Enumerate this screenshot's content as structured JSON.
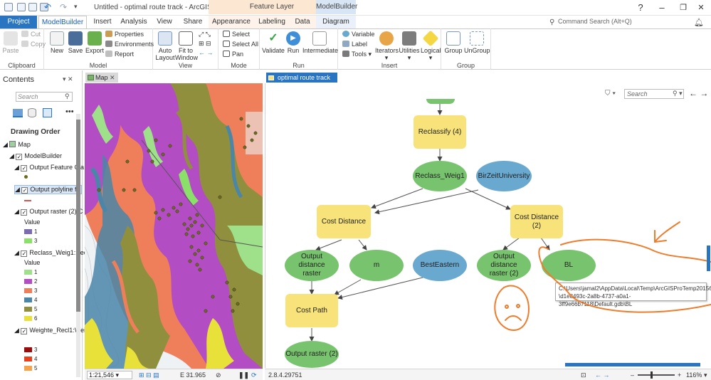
{
  "window": {
    "title": "Untitled - optimal route track - ArcGIS Pro",
    "help": "?",
    "minimize": "–",
    "restore": "❐",
    "close": "✕"
  },
  "context_headers": {
    "feature_layer": "Feature Layer",
    "modelbuilder": "ModelBuilder"
  },
  "tabs": [
    "Project",
    "ModelBuilder",
    "Insert",
    "Analysis",
    "View",
    "Share",
    "Appearance",
    "Labeling",
    "Data",
    "Diagram"
  ],
  "command_search_placeholder": "Command Search (Alt+Q)",
  "ribbon": {
    "clipboard": {
      "paste": "Paste",
      "cut": "Cut",
      "copy": "Copy",
      "label": "Clipboard"
    },
    "model": {
      "new": "New",
      "save": "Save",
      "export": "Export",
      "properties": "Properties",
      "environments": "Environments",
      "report": "Report",
      "label": "Model"
    },
    "view": {
      "auto_layout": "Auto Layout",
      "fit_to_window": "Fit to Window",
      "label": "View"
    },
    "mode": {
      "select": "Select",
      "select_all": "Select All",
      "pan": "Pan",
      "label": "Mode"
    },
    "run": {
      "validate": "Validate",
      "run": "Run",
      "intermediate": "Intermediate",
      "label": "Run"
    },
    "insert": {
      "variable": "Variable",
      "label_btn": "Label",
      "tools": "Tools",
      "iterators": "Iterators",
      "utilities": "Utilities",
      "logical": "Logical",
      "label": "Insert"
    },
    "group": {
      "group": "Group",
      "ungroup": "UnGroup",
      "label": "Group"
    }
  },
  "contents": {
    "title": "Contents",
    "search_placeholder": "Search",
    "drawing_order": "Drawing Order",
    "items": {
      "map": "Map",
      "modelbuilder": "ModelBuilder",
      "output_feature": "Output Feature Cla",
      "output_polyline": "Output polyline fe",
      "output_raster": "Output raster (2):C",
      "value1": "Value",
      "reclass": "Reclass_Weig1:Rec",
      "value2": "Value",
      "weighted": "Weighte_Recl1:Wei"
    },
    "legend1": [
      "1",
      "3"
    ],
    "legend2": [
      "1",
      "2",
      "3",
      "4",
      "5",
      "6"
    ],
    "legend3": [
      "3",
      "4",
      "5"
    ],
    "colors": {
      "purple": "#7b6bb0",
      "green": "#8be06a",
      "lightgreen": "#9fe08a",
      "magenta": "#b34dc4",
      "salmon": "#ef7f5a",
      "steel": "#4a86a8",
      "olive": "#8f8f3e",
      "yellow": "#e8e13a",
      "darkred": "#9b0b0b",
      "red": "#e8401c",
      "orange": "#f6a24b"
    }
  },
  "map": {
    "tab_label": "Map",
    "scale": "1:21,546",
    "coords": "E 31.965"
  },
  "modelbuilder": {
    "tab_label": "optimal route track",
    "search_placeholder": "Search",
    "nodes": {
      "reclassify": "Reclassify (4)",
      "reclass_weig1": "Reclass_Weig1",
      "birzeit": "BirZeitUniversity",
      "cost_distance": "Cost Distance",
      "cost_distance2": "Cost Distance (2)",
      "output_distance": "Output distance raster",
      "m": "m",
      "besteastern": "BestEastern",
      "output_distance2": "Output distance raster (2)",
      "bl": "BL",
      "cost_path": "Cost Path",
      "output_raster2": "Output raster (2)"
    },
    "tooltip": [
      "C:\\Users\\jamal2\\AppData\\Local\\Temp\\ArcGISProTemp20156",
      "\\d1e8493c-2a8b-4737-a0a1-3ff9e66b7118\\Default.gdb\\BL"
    ],
    "version": "2.8.4.29751",
    "zoom": "116%"
  }
}
